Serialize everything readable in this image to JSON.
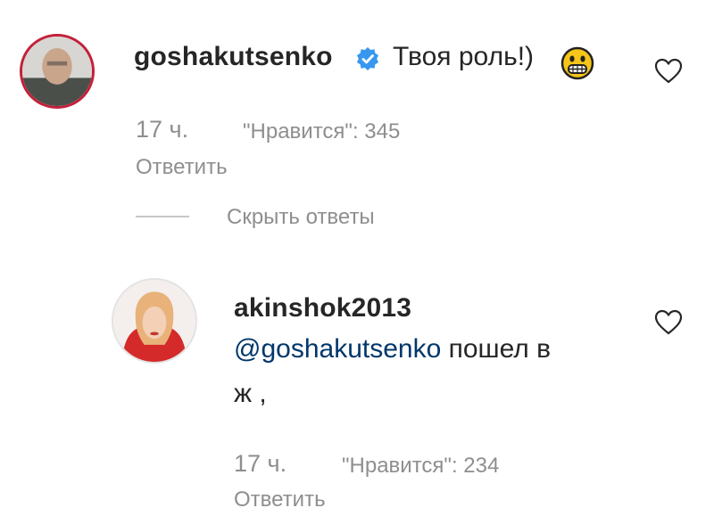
{
  "comments": [
    {
      "username": "goshakutsenko",
      "verified": true,
      "text": "Твоя роль!)",
      "emoji": "grinning-face-with-big-eyes",
      "time": "17 ч.",
      "likes": "\"Нравится\": 345",
      "reply_label": "Ответить"
    }
  ],
  "hide_replies": "Скрыть ответы",
  "replies": [
    {
      "username": "akinshok2013",
      "mention": "@goshakutsenko",
      "text_line1": " пошел в",
      "text_line2": "ж ,",
      "time": "17 ч.",
      "likes": "\"Нравится\": 234",
      "reply_label": "Ответить"
    }
  ],
  "colors": {
    "avatar_ring": "#c4203a",
    "verified_badge": "#3897f0",
    "mention": "#00376b",
    "meta": "#8e8e8e"
  }
}
